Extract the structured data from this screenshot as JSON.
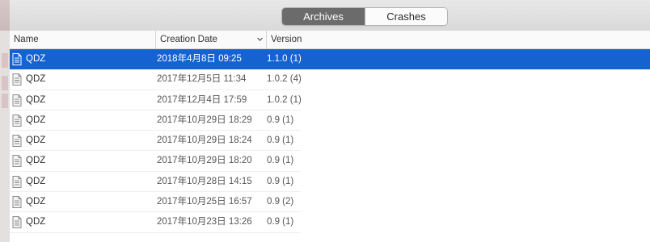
{
  "tabs": [
    {
      "label": "Archives",
      "selected": true
    },
    {
      "label": "Crashes",
      "selected": false
    }
  ],
  "columns": {
    "name": "Name",
    "date": "Creation Date",
    "version": "Version"
  },
  "sort": {
    "column": "Creation Date",
    "direction": "descending",
    "icon": "chevron-down-icon"
  },
  "rows": [
    {
      "name": "QDZ",
      "date": "2018年4月8日 09:25",
      "version": "1.1.0 (1)",
      "selected": true
    },
    {
      "name": "QDZ",
      "date": "2017年12月5日 11:34",
      "version": "1.0.2 (4)"
    },
    {
      "name": "QDZ",
      "date": "2017年12月4日 17:59",
      "version": "1.0.2 (1)"
    },
    {
      "name": "QDZ",
      "date": "2017年10月29日 18:29",
      "version": "0.9 (1)"
    },
    {
      "name": "QDZ",
      "date": "2017年10月29日 18:24",
      "version": "0.9 (1)"
    },
    {
      "name": "QDZ",
      "date": "2017年10月29日 18:20",
      "version": "0.9 (1)"
    },
    {
      "name": "QDZ",
      "date": "2017年10月28日 14:15",
      "version": "0.9 (1)"
    },
    {
      "name": "QDZ",
      "date": "2017年10月25日 16:57",
      "version": "0.9 (2)"
    },
    {
      "name": "QDZ",
      "date": "2017年10月23日 13:26",
      "version": "0.9 (1)"
    }
  ],
  "row_icon": "archive-document-icon",
  "colors": {
    "selection": "#1463d0",
    "segment_active": "#6b6b6b"
  }
}
